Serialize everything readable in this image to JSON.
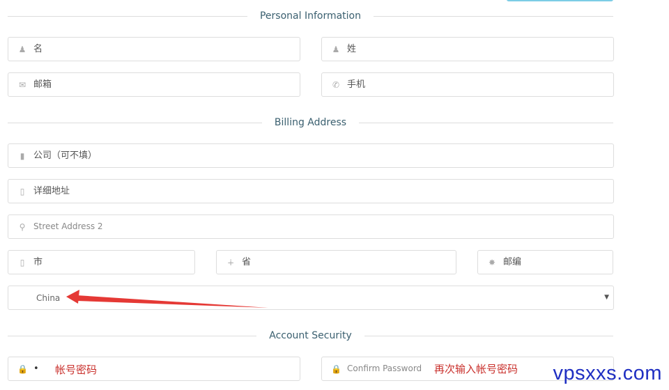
{
  "sections": {
    "personal": "Personal Information",
    "billing": "Billing Address",
    "security": "Account Security"
  },
  "fields": {
    "first_name": {
      "placeholder": "名",
      "icon": "user-icon"
    },
    "last_name": {
      "placeholder": "姓",
      "icon": "user-icon"
    },
    "email": {
      "placeholder": "邮箱",
      "icon": "envelope-icon"
    },
    "phone": {
      "placeholder": "手机",
      "icon": "phone-icon"
    },
    "company": {
      "placeholder": "公司（可不填）",
      "icon": "building-icon"
    },
    "address1": {
      "placeholder": "详细地址",
      "icon": "building-icon"
    },
    "address2": {
      "placeholder": "Street Address 2",
      "icon": "map-marker-icon"
    },
    "city": {
      "placeholder": "市",
      "icon": "building-icon"
    },
    "state": {
      "placeholder": "省",
      "icon": "state-icon"
    },
    "zip": {
      "placeholder": "邮编",
      "icon": "certificate-icon"
    },
    "country": {
      "value": "China"
    },
    "password": {
      "value": "•",
      "icon": "lock-icon"
    },
    "confirm_password": {
      "placeholder": "Confirm Password",
      "icon": "lock-icon"
    }
  },
  "annotations": {
    "password_note": "帐号密码",
    "confirm_note": "再次输入帐号密码",
    "arrow_color": "#e53935"
  },
  "watermark": "vpsxxs.com"
}
